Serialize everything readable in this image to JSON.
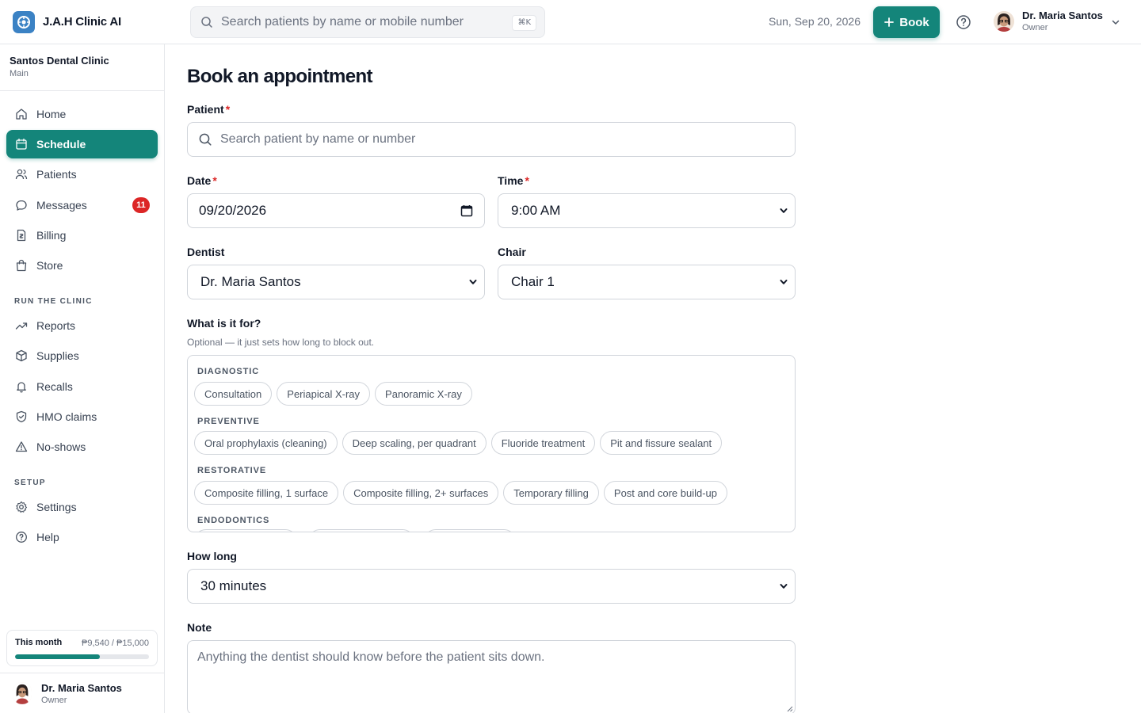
{
  "app": {
    "name": "J.A.H Clinic AI"
  },
  "header": {
    "search_placeholder": "Search patients by name or mobile number",
    "shortcut": "⌘K",
    "date": "Sun, Sep 20, 2026",
    "book_label": "Book",
    "user": {
      "name": "Dr. Maria Santos",
      "role": "Owner"
    }
  },
  "sidebar": {
    "clinic_name": "Santos Dental Clinic",
    "branch": "Main",
    "items": [
      {
        "label": "Home",
        "icon": "home-icon"
      },
      {
        "label": "Schedule",
        "icon": "calendar-icon",
        "active": true
      },
      {
        "label": "Patients",
        "icon": "users-icon"
      },
      {
        "label": "Messages",
        "icon": "message-icon",
        "badge": "11"
      },
      {
        "label": "Billing",
        "icon": "receipt-icon"
      },
      {
        "label": "Store",
        "icon": "shopping-bag-icon"
      }
    ],
    "section_run": "RUN THE CLINIC",
    "run_items": [
      {
        "label": "Reports",
        "icon": "trending-up-icon"
      },
      {
        "label": "Supplies",
        "icon": "box-icon"
      },
      {
        "label": "Recalls",
        "icon": "bell-icon"
      },
      {
        "label": "HMO claims",
        "icon": "shield-check-icon"
      },
      {
        "label": "No-shows",
        "icon": "warning-icon"
      }
    ],
    "section_setup": "SETUP",
    "setup_items": [
      {
        "label": "Settings",
        "icon": "gear-icon"
      },
      {
        "label": "Help",
        "icon": "help-icon"
      }
    ],
    "usage": {
      "label": "This month",
      "value": "₱9,540 / ₱15,000",
      "fraction": 0.636
    },
    "user": {
      "name": "Dr. Maria Santos",
      "role": "Owner"
    }
  },
  "form": {
    "title": "Book an appointment",
    "patient_label": "Patient",
    "patient_placeholder": "Search patient by name or number",
    "date_label": "Date",
    "date_value": "09/20/2026",
    "time_label": "Time",
    "time_value": "9:00 AM",
    "dentist_label": "Dentist",
    "dentist_value": "Dr. Maria Santos",
    "chair_label": "Chair",
    "chair_value": "Chair 1",
    "purpose_label": "What is it for?",
    "purpose_hint": "Optional — it just sets how long to block out.",
    "categories": [
      {
        "name": "DIAGNOSTIC",
        "services": [
          "Consultation",
          "Periapical X-ray",
          "Panoramic X-ray"
        ]
      },
      {
        "name": "PREVENTIVE",
        "services": [
          "Oral prophylaxis (cleaning)",
          "Deep scaling, per quadrant",
          "Fluoride treatment",
          "Pit and fissure sealant"
        ]
      },
      {
        "name": "RESTORATIVE",
        "services": [
          "Composite filling, 1 surface",
          "Composite filling, 2+ surfaces",
          "Temporary filling",
          "Post and core build-up"
        ]
      },
      {
        "name": "ENDODONTICS",
        "services": []
      }
    ],
    "duration_label": "How long",
    "duration_value": "30 minutes",
    "note_label": "Note",
    "note_placeholder": "Anything the dentist should know before the patient sits down."
  },
  "colors": {
    "accent": "#14857a",
    "badge": "#dc2626",
    "logo": "#3b82c4"
  }
}
